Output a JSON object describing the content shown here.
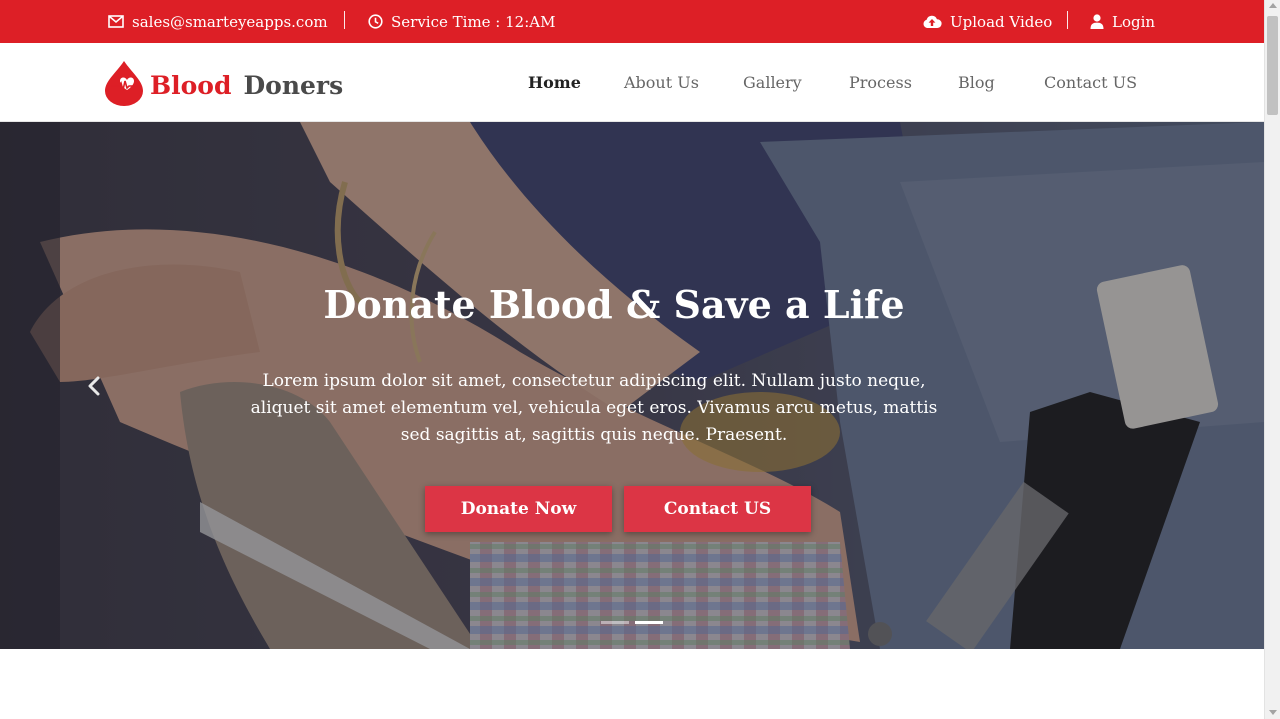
{
  "topbar": {
    "email": "sales@smarteyeapps.com",
    "service_time": "Service Time : 12:AM",
    "upload_video": "Upload Video",
    "login": "Login",
    "background_color": "#dd1f26"
  },
  "brand": {
    "word1": "Blood",
    "word2": "Doners",
    "icon": "blood-drop-heartbeat-icon"
  },
  "nav": {
    "home": "Home",
    "about": "About Us",
    "gallery": "Gallery",
    "process": "Process",
    "blog": "Blog",
    "contact": "Contact US",
    "active": "Home"
  },
  "hero": {
    "title": "Donate Blood & Save a Life",
    "text": "Lorem ipsum dolor sit amet, consectetur adipiscing elit. Nullam justo neque, aliquet sit amet elementum vel, vehicula eget eros. Vivamus arcu metus, mattis sed sagittis at, sagittis quis neque. Praesent.",
    "donate_button": "Donate Now",
    "contact_button": "Contact US",
    "button_color": "#dc3545",
    "prev_icon": "chevron-left-icon"
  },
  "carousel": {
    "slides": 2,
    "active_slide": 2
  }
}
